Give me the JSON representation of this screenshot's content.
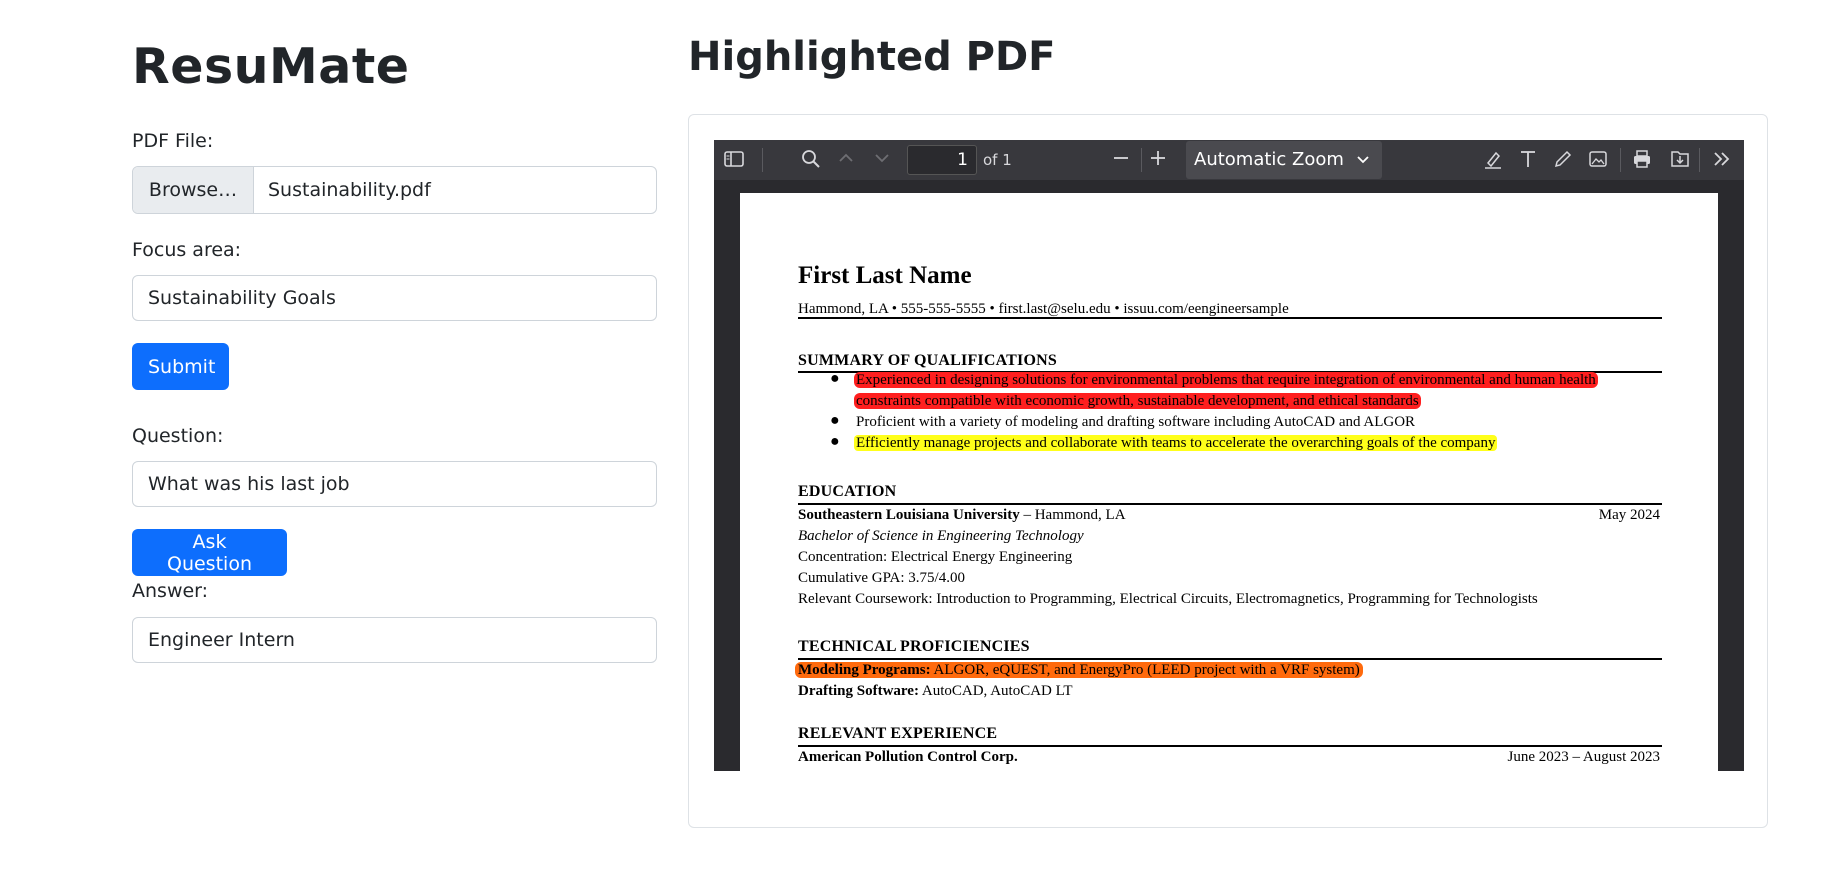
{
  "app": {
    "title": "ResuMate"
  },
  "form": {
    "pdf_label": "PDF File:",
    "browse_label": "Browse…",
    "file_name": "Sustainability.pdf",
    "focus_label": "Focus area:",
    "focus_value": "Sustainability Goals",
    "submit_label": "Submit",
    "question_label": "Question:",
    "question_value": "What was his last job",
    "ask_label": "Ask Question",
    "answer_label": "Answer:",
    "answer_value": "Engineer Intern"
  },
  "viewer": {
    "heading": "Highlighted PDF",
    "page_number": "1",
    "page_of": "of 1",
    "zoom": "Automatic Zoom",
    "icons": [
      "sidebar-toggle-icon",
      "search-icon",
      "previous-page-icon",
      "next-page-icon",
      "zoom-out-icon",
      "zoom-in-icon",
      "highlight-icon",
      "text-icon",
      "draw-icon",
      "image-icon",
      "print-icon",
      "save-icon",
      "more-tools-icon"
    ]
  },
  "resume": {
    "name": "First Last Name",
    "contact": "Hammond, LA • 555-555-5555 • first.last@selu.edu • issuu.com/eengineersample",
    "summary_title": "SUMMARY OF QUALIFICATIONS",
    "summary": [
      {
        "text1": "Experienced in designing solutions for environmental problems that require integration of environmental and human health",
        "text2": "constraints compatible with economic growth, sustainable development, and ethical standards",
        "highlight": "red",
        "highlight_color": "#ff1f1f"
      },
      {
        "text1": "Proficient with a variety of modeling and drafting software including AutoCAD and ALGOR",
        "highlight": "none"
      },
      {
        "text1": "Efficiently manage projects and collaborate with teams to accelerate the overarching goals of the company",
        "highlight": "yellow",
        "highlight_color": "#ffff1a"
      }
    ],
    "education_title": "EDUCATION",
    "edu_school": "Southeastern Louisiana University",
    "edu_location": " – Hammond, LA",
    "edu_date": "May 2024",
    "edu_degree": "Bachelor of Science in Engineering Technology",
    "edu_concentration": "Concentration: Electrical Energy Engineering",
    "edu_gpa": "Cumulative GPA: 3.75/4.00",
    "edu_coursework": "Relevant Coursework: Introduction to Programming, Electrical Circuits, Electromagnetics, Programming for Technologists",
    "tech_title": "TECHNICAL PROFICIENCIES",
    "tech_modeling_label": "Modeling Programs:",
    "tech_modeling_value": " ALGOR, eQUEST, and EnergyPro (LEED project with a VRF system)",
    "tech_modeling_highlight_color": "#ff6a0d",
    "tech_drafting_label": "Drafting Software:",
    "tech_drafting_value": " AutoCAD, AutoCAD LT",
    "exp_title": "RELEVANT EXPERIENCE",
    "exp_company": "American Pollution Control Corp.",
    "exp_date": "June 2023 – August 2023"
  },
  "colors": {
    "primary_button": "#0d6efd",
    "viewer_toolbar": "#38383d",
    "viewer_background": "#2a2a2e"
  }
}
